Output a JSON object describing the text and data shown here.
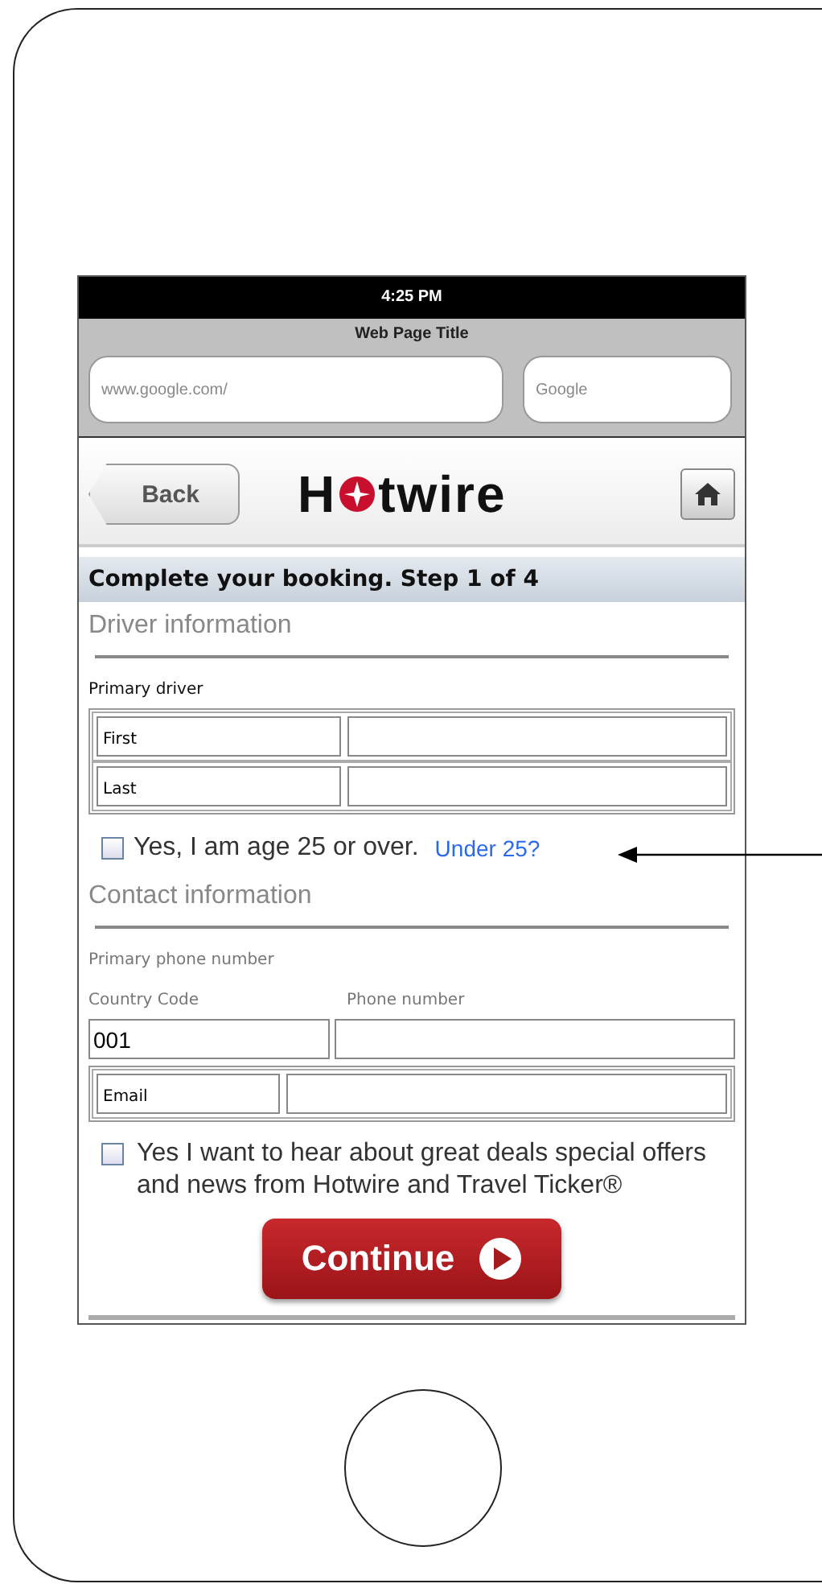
{
  "status_bar": {
    "time": "4:25 PM"
  },
  "browser": {
    "title": "Web Page Title",
    "address": {
      "placeholder": "www.google.com/"
    },
    "search": {
      "placeholder": "Google"
    }
  },
  "header": {
    "back": "Back",
    "logo": {
      "before": "H",
      "after": "twire"
    }
  },
  "heading": "Complete your booking. Step 1 of 4",
  "driver": {
    "title": "Driver information",
    "subtitle": "Primary driver",
    "rows": [
      {
        "label": "First",
        "value": ""
      },
      {
        "label": "Last",
        "value": ""
      }
    ],
    "age_check": {
      "label": "Yes, I am age 25 or over.",
      "checked": false
    },
    "link": "Under 25?"
  },
  "contact": {
    "title": "Contact information",
    "subtitle": "Primary phone number",
    "country_label": "Country Code",
    "phone_label": "Phone number",
    "country_value": "001",
    "email_label": "Email",
    "offers_check": {
      "label": "Yes I want to hear about great deals special offers and news from Hotwire and Travel Ticker®",
      "checked": false
    }
  },
  "continue": "Continue"
}
